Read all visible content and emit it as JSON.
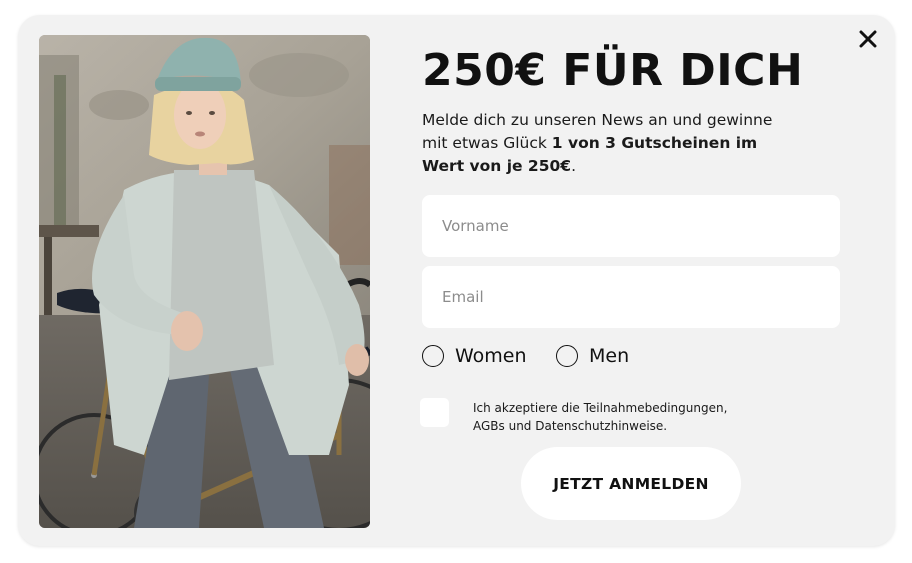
{
  "popup": {
    "title": "250€ FÜR DICH",
    "description_text": "Melde dich zu unseren News an und gewinne mit etwas Glück ",
    "description_bold": "1 von 3 Gutscheinen im Wert von je 250€",
    "description_end": ".",
    "close_icon": "close-icon",
    "image_alt": "woman-in-knit-cardigan-with-bicycle"
  },
  "form": {
    "first_name_placeholder": "Vorname",
    "first_name_value": "",
    "email_placeholder": "Email",
    "email_value": "",
    "gender_options": [
      "Women",
      "Men"
    ],
    "gender_selected": null,
    "consent_checked": false,
    "consent_line1": "Ich akzeptiere die Teilnahmebedingungen,",
    "consent_line2": "AGBs und Datenschutzhinweise.",
    "submit_label": "JETZT ANMELDEN"
  },
  "colors": {
    "modal_background": "#f2f2f2",
    "field_background": "#ffffff",
    "text": "#111111",
    "placeholder": "#8c8c8c"
  }
}
